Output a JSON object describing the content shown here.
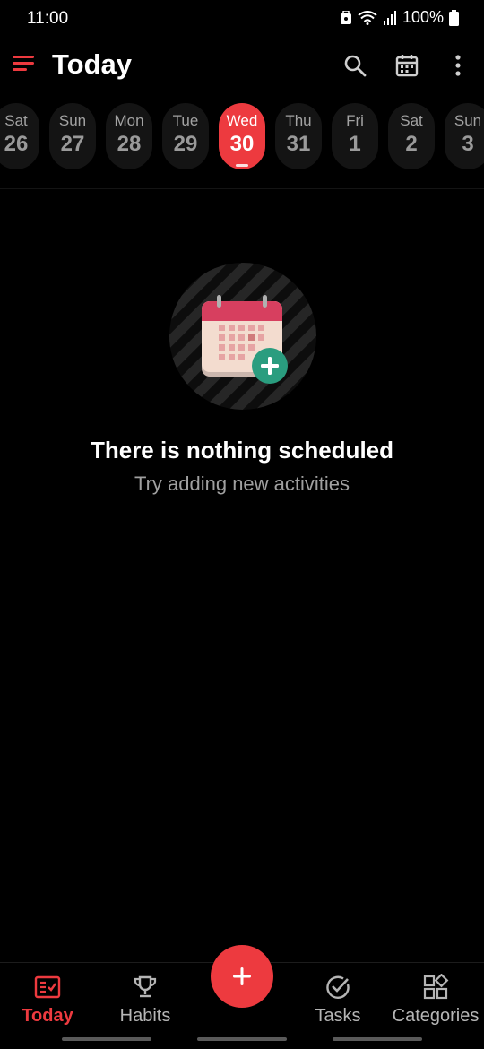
{
  "status_bar": {
    "time": "11:00",
    "battery": "100%"
  },
  "app_bar": {
    "title": "Today",
    "icons": [
      "menu-icon",
      "search-icon",
      "calendar-icon",
      "more-vert-icon"
    ]
  },
  "date_strip": {
    "days": [
      {
        "name": "Sat",
        "num": "26",
        "selected": false
      },
      {
        "name": "Sun",
        "num": "27",
        "selected": false
      },
      {
        "name": "Mon",
        "num": "28",
        "selected": false
      },
      {
        "name": "Tue",
        "num": "29",
        "selected": false
      },
      {
        "name": "Wed",
        "num": "30",
        "selected": true
      },
      {
        "name": "Thu",
        "num": "31",
        "selected": false
      },
      {
        "name": "Fri",
        "num": "1",
        "selected": false
      },
      {
        "name": "Sat",
        "num": "2",
        "selected": false
      },
      {
        "name": "Sun",
        "num": "3",
        "selected": false
      }
    ]
  },
  "empty_state": {
    "title": "There is nothing scheduled",
    "subtitle": "Try adding new activities"
  },
  "bottom_nav": {
    "items": [
      {
        "label": "Today",
        "icon": "today-checklist-icon",
        "active": true
      },
      {
        "label": "Habits",
        "icon": "trophy-icon",
        "active": false
      },
      {
        "label": "Tasks",
        "icon": "check-circle-icon",
        "active": false
      },
      {
        "label": "Categories",
        "icon": "categories-grid-icon",
        "active": false
      }
    ],
    "fab_icon": "plus-icon"
  },
  "colors": {
    "accent": "#ed3a3f",
    "background": "#000000",
    "chip": "#141414",
    "teal": "#2a9d7f"
  }
}
